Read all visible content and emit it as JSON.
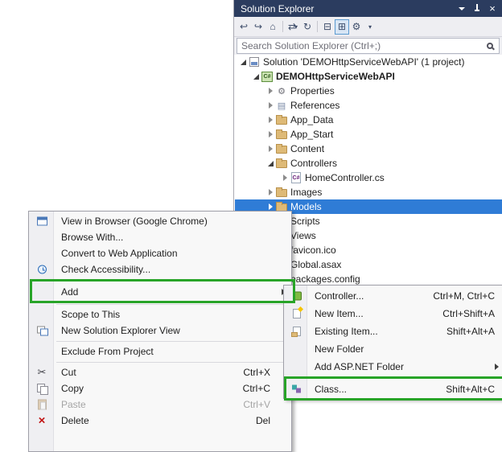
{
  "colors": {
    "titlebar_bg": "#2B3C5F",
    "selection_bg": "#2F7CD6",
    "annotation_green": "#28A428",
    "toolbar_bg": "#EEEEF2",
    "folder": "#DEBA77"
  },
  "icons": {
    "close": "×",
    "window_position": "▾",
    "back": "↩",
    "forward": "↪",
    "home": "⌂",
    "sync": "⇄",
    "caret": "▾",
    "refresh": "↻",
    "collapse_all": "⊟",
    "show_all_files": "⊞",
    "properties": "⚙",
    "references": "▤",
    "scissors": "✂",
    "csharp": "C#"
  },
  "solution_explorer": {
    "title": "Solution Explorer",
    "search_placeholder": "Search Solution Explorer (Ctrl+;)",
    "tree": [
      {
        "label": "Solution 'DEMOHttpServiceWebAPI' (1 project)"
      },
      {
        "label": "DEMOHttpServiceWebAPI"
      },
      {
        "label": "Properties"
      },
      {
        "label": "References"
      },
      {
        "label": "App_Data"
      },
      {
        "label": "App_Start"
      },
      {
        "label": "Content"
      },
      {
        "label": "Controllers"
      },
      {
        "label": "HomeController.cs"
      },
      {
        "label": "Images"
      },
      {
        "label": "Models",
        "selected": true
      },
      {
        "label": "Scripts"
      },
      {
        "label": "Views"
      },
      {
        "label": "favicon.ico"
      },
      {
        "label": "Global.asax"
      },
      {
        "label": "packages.config"
      }
    ]
  },
  "context_menu": {
    "items": [
      {
        "label": "View in Browser (Google Chrome)",
        "shortcut": ""
      },
      {
        "label": "Browse With...",
        "shortcut": ""
      },
      {
        "label": "Convert to Web Application",
        "shortcut": ""
      },
      {
        "label": "Check Accessibility...",
        "shortcut": ""
      },
      {
        "label": "Add",
        "shortcut": "",
        "has_submenu": true,
        "highlighted": true
      },
      {
        "label": "Scope to This",
        "shortcut": ""
      },
      {
        "label": "New Solution Explorer View",
        "shortcut": ""
      },
      {
        "label": "Exclude From Project",
        "shortcut": ""
      },
      {
        "label": "Cut",
        "shortcut": "Ctrl+X"
      },
      {
        "label": "Copy",
        "shortcut": "Ctrl+C"
      },
      {
        "label": "Paste",
        "shortcut": "Ctrl+V",
        "disabled": true
      },
      {
        "label": "Delete",
        "shortcut": "Del"
      }
    ]
  },
  "add_submenu": {
    "items": [
      {
        "label": "Controller...",
        "shortcut": "Ctrl+M, Ctrl+C"
      },
      {
        "label": "New Item...",
        "shortcut": "Ctrl+Shift+A"
      },
      {
        "label": "Existing Item...",
        "shortcut": "Shift+Alt+A"
      },
      {
        "label": "New Folder",
        "shortcut": ""
      },
      {
        "label": "Add ASP.NET Folder",
        "shortcut": "",
        "has_submenu": true
      },
      {
        "label": "Class...",
        "shortcut": "Shift+Alt+C",
        "highlighted": true
      }
    ]
  }
}
